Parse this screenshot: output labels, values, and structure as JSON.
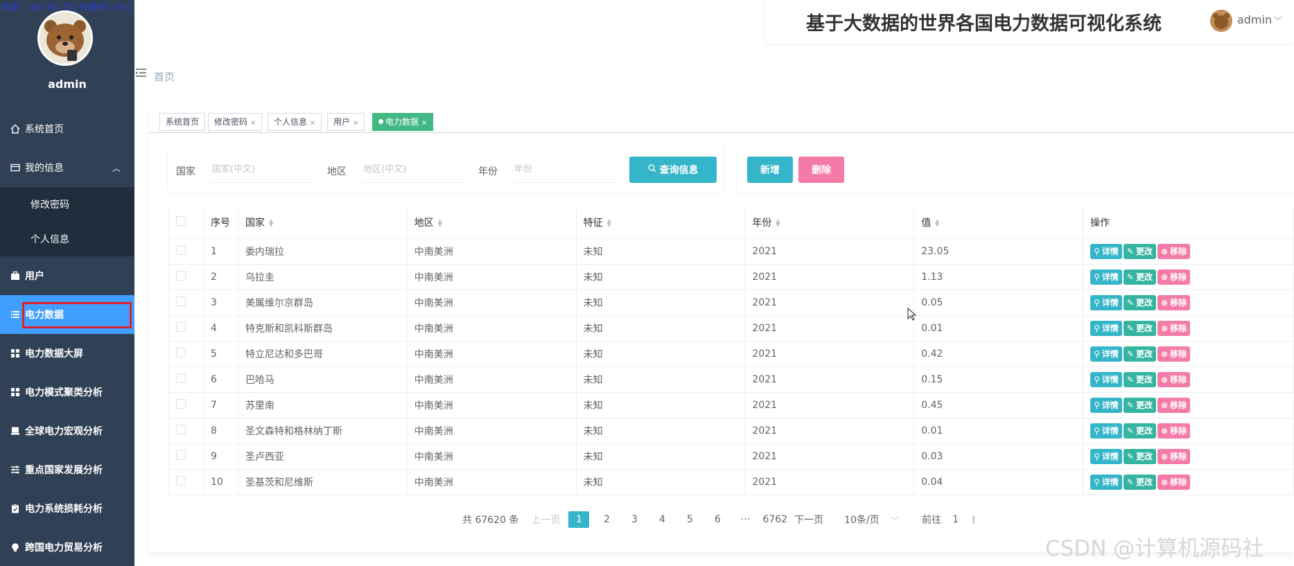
{
  "recording": "搜索: 00:00:25(关键帧)(9%)",
  "sidebar": {
    "username": "admin",
    "items": [
      {
        "label": "系统首页",
        "icon": "home-icon"
      },
      {
        "label": "我的信息",
        "icon": "card-icon"
      },
      {
        "label": "用户",
        "icon": "briefcase-icon"
      },
      {
        "label": "电力数据",
        "icon": "list-icon"
      },
      {
        "label": "电力数据大屏",
        "icon": "grid-icon"
      },
      {
        "label": "电力模式聚类分析",
        "icon": "grid-icon"
      },
      {
        "label": "全球电力宏观分析",
        "icon": "printer-icon"
      },
      {
        "label": "重点国家发展分析",
        "icon": "sliders-icon"
      },
      {
        "label": "电力系统损耗分析",
        "icon": "clipboard-icon"
      },
      {
        "label": "跨国电力贸易分析",
        "icon": "bulb-icon"
      }
    ],
    "submenu": [
      "修改密码",
      "个人信息"
    ]
  },
  "header": {
    "title": "基于大数据的世界各国电力数据可视化系统",
    "user": "admin"
  },
  "breadcrumb": "首页",
  "tabs": [
    "系统首页",
    "修改密码",
    "个人信息",
    "用户",
    "电力数据"
  ],
  "search": {
    "country_label": "国家",
    "country_placeholder": "国家(中文)",
    "region_label": "地区",
    "region_placeholder": "地区(中文)",
    "year_label": "年份",
    "year_placeholder": "年份",
    "query_button": "查询信息",
    "add_button": "新增",
    "delete_button": "删除"
  },
  "table": {
    "headers": [
      "序号",
      "国家",
      "地区",
      "特征",
      "年份",
      "值",
      "操作"
    ],
    "rows": [
      [
        "1",
        "委内瑞拉",
        "中南美洲",
        "未知",
        "2021",
        "23.05"
      ],
      [
        "2",
        "乌拉圭",
        "中南美洲",
        "未知",
        "2021",
        "1.13"
      ],
      [
        "3",
        "美属维尔京群岛",
        "中南美洲",
        "未知",
        "2021",
        "0.05"
      ],
      [
        "4",
        "特克斯和凯科斯群岛",
        "中南美洲",
        "未知",
        "2021",
        "0.01"
      ],
      [
        "5",
        "特立尼达和多巴哥",
        "中南美洲",
        "未知",
        "2021",
        "0.42"
      ],
      [
        "6",
        "巴哈马",
        "中南美洲",
        "未知",
        "2021",
        "0.15"
      ],
      [
        "7",
        "苏里南",
        "中南美洲",
        "未知",
        "2021",
        "0.45"
      ],
      [
        "8",
        "圣文森特和格林纳丁斯",
        "中南美洲",
        "未知",
        "2021",
        "0.01"
      ],
      [
        "9",
        "圣卢西亚",
        "中南美洲",
        "未知",
        "2021",
        "0.03"
      ],
      [
        "10",
        "圣基茨和尼维斯",
        "中南美洲",
        "未知",
        "2021",
        "0.04"
      ]
    ],
    "actions": [
      "详情",
      "更改",
      "移除"
    ]
  },
  "pagination": {
    "total": "共 67620 条",
    "prev": "上一页",
    "pages": [
      "1",
      "2",
      "3",
      "4",
      "5",
      "6"
    ],
    "ellipsis": "···",
    "last": "6762",
    "next": "下一页",
    "size": "10条/页",
    "goto": "前往",
    "goto_value": "1",
    "goto_suffix": "页"
  },
  "watermark": "CSDN @计算机源码社",
  "colors": {
    "sidebar": "#304156",
    "active": "#409eff",
    "accent": "#35b5c9",
    "danger": "#f47ba8",
    "tag_active": "#42b983"
  }
}
